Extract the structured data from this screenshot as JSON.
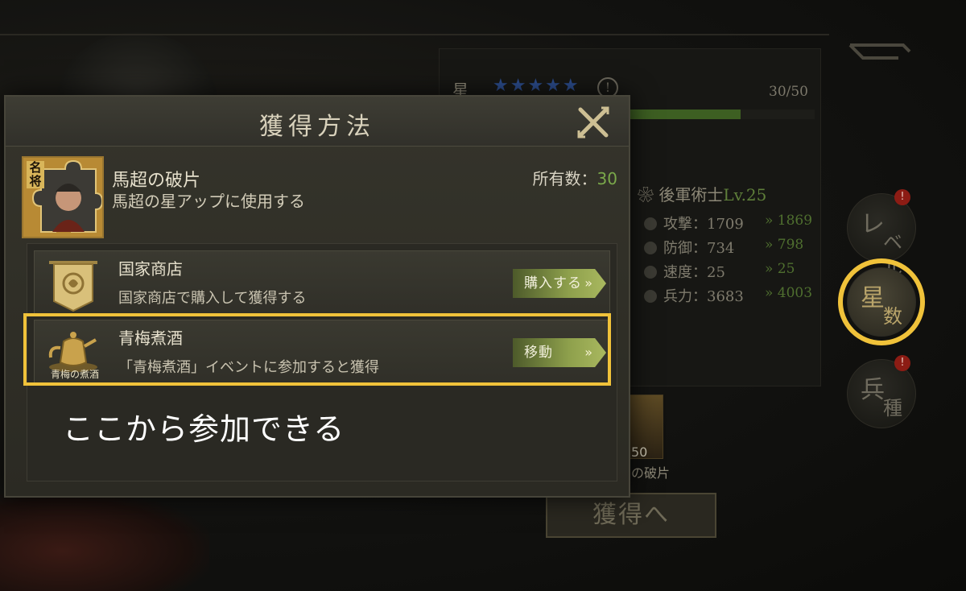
{
  "background": {
    "star_label": "星",
    "stars": "★★★★★",
    "info_symbol": "!",
    "progress_text": "30/50",
    "progress_fraction": 0.6,
    "unit_label": "後軍術士",
    "unit_level": "Lv.25",
    "stats": [
      {
        "label": "攻撃：1709",
        "new": "» 1869"
      },
      {
        "label": "防御：734",
        "new": "» 798"
      },
      {
        "label": "速度：25",
        "new": "» 25"
      },
      {
        "label": "兵力：3683",
        "new": "» 4003"
      }
    ],
    "side_buttons": {
      "level": {
        "c1": "レ",
        "c2": "ベル",
        "badge": "!"
      },
      "stars": {
        "c1": "星",
        "c2": "数"
      },
      "troops": {
        "c1": "兵",
        "c2": "種",
        "badge": "!"
      }
    },
    "shard_count": "50",
    "shard_name": "の破片",
    "acquire_button": "獲得へ"
  },
  "modal": {
    "title": "獲得方法",
    "item": {
      "icon_text": "名将",
      "name": "馬超の破片",
      "description": "馬超の星アップに使用する",
      "owned_label": "所有数：",
      "owned_value": "30"
    },
    "sources": [
      {
        "name": "国家商店",
        "description": "国家商店で購入して獲得する",
        "button": "購入する"
      },
      {
        "name": "青梅煮酒",
        "description": "「青梅煮酒」イベントに参加すると獲得",
        "button": "移動",
        "icon_caption": "青梅の煮酒"
      }
    ]
  },
  "annotation": {
    "caption": "ここから参加できる",
    "highlight_color": "#f0c23a"
  },
  "colors": {
    "accent_gold": "#f0c23a",
    "owned_green": "#7aa84a",
    "button_green": "#8ea04c"
  }
}
